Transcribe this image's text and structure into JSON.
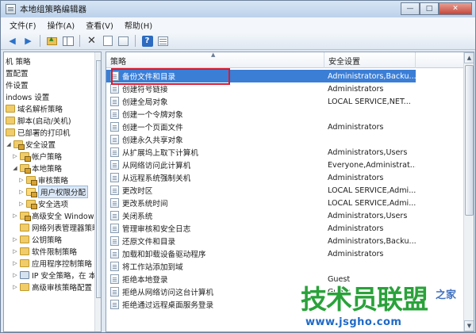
{
  "window": {
    "title": "本地组策略编辑器",
    "controls": {
      "minimize": "—",
      "maximize": "□",
      "close": "✕"
    }
  },
  "menubar": {
    "items": [
      "文件(F)",
      "操作(A)",
      "查看(V)",
      "帮助(H)"
    ]
  },
  "toolbar": {
    "icons": [
      "back-icon",
      "forward-icon",
      "up-folder-icon",
      "show-tree-icon",
      "delete-icon",
      "properties-icon",
      "export-icon",
      "help-icon",
      "view-icon"
    ]
  },
  "tree": {
    "items": [
      {
        "label": "机 策略",
        "icon": "none"
      },
      {
        "label": "置配置",
        "icon": "none"
      },
      {
        "label": "件设置",
        "icon": "none"
      },
      {
        "label": "indows 设置",
        "icon": "none"
      },
      {
        "label": "域名解析策略",
        "icon": "folder"
      },
      {
        "label": "脚本(启动/关机)",
        "icon": "folder"
      },
      {
        "label": "已部署的打印机",
        "icon": "folder"
      },
      {
        "label": "安全设置",
        "icon": "folder"
      },
      {
        "label": "帐户策略",
        "icon": "folder"
      },
      {
        "label": "本地策略",
        "icon": "folder"
      },
      {
        "label": "审核策略",
        "icon": "folder"
      },
      {
        "label": "用户权限分配",
        "icon": "folder",
        "selected": true
      },
      {
        "label": "安全选项",
        "icon": "folder"
      },
      {
        "label": "高级安全 Windows",
        "icon": "folder"
      },
      {
        "label": "网络列表管理器策略",
        "icon": "folder"
      },
      {
        "label": "公钥策略",
        "icon": "folder"
      },
      {
        "label": "软件限制策略",
        "icon": "folder"
      },
      {
        "label": "应用程序控制策略",
        "icon": "folder"
      },
      {
        "label": "IP 安全策略，在 本",
        "icon": "computer"
      },
      {
        "label": "高级审核策略配置",
        "icon": "folder"
      }
    ]
  },
  "list": {
    "columns": {
      "policy": "策略",
      "setting": "安全设置"
    },
    "rows": [
      {
        "policy": "备份文件和目录",
        "setting": "Administrators,Backu...",
        "highlight": true
      },
      {
        "policy": "创建符号链接",
        "setting": "Administrators"
      },
      {
        "policy": "创建全局对象",
        "setting": "LOCAL SERVICE,NET..."
      },
      {
        "policy": "创建一个令牌对象",
        "setting": ""
      },
      {
        "policy": "创建一个页面文件",
        "setting": "Administrators"
      },
      {
        "policy": "创建永久共享对象",
        "setting": ""
      },
      {
        "policy": "从扩展坞上取下计算机",
        "setting": "Administrators,Users"
      },
      {
        "policy": "从网络访问此计算机",
        "setting": "Everyone,Administrat..."
      },
      {
        "policy": "从远程系统强制关机",
        "setting": "Administrators"
      },
      {
        "policy": "更改时区",
        "setting": "LOCAL SERVICE,Admi..."
      },
      {
        "policy": "更改系统时间",
        "setting": "LOCAL SERVICE,Admi..."
      },
      {
        "policy": "关闭系统",
        "setting": "Administrators,Users"
      },
      {
        "policy": "管理审核和安全日志",
        "setting": "Administrators"
      },
      {
        "policy": "还原文件和目录",
        "setting": "Administrators,Backu..."
      },
      {
        "policy": "加载和卸载设备驱动程序",
        "setting": "Administrators"
      },
      {
        "policy": "将工作站添加到域",
        "setting": ""
      },
      {
        "policy": "拒绝本地登录",
        "setting": "Guest"
      },
      {
        "policy": "拒绝从网络访问这台计算机",
        "setting": "Guest"
      },
      {
        "policy": "拒绝通过远程桌面服务登录",
        "setting": ""
      }
    ]
  },
  "watermark": {
    "brand": "技术员联盟",
    "suffix": "之家",
    "url": "www.jsgho.com"
  },
  "colors": {
    "selection": "#3b7ed6",
    "callout_border": "#e0162a",
    "watermark_green": "#2aa23a",
    "watermark_blue": "#1f6ac7"
  }
}
